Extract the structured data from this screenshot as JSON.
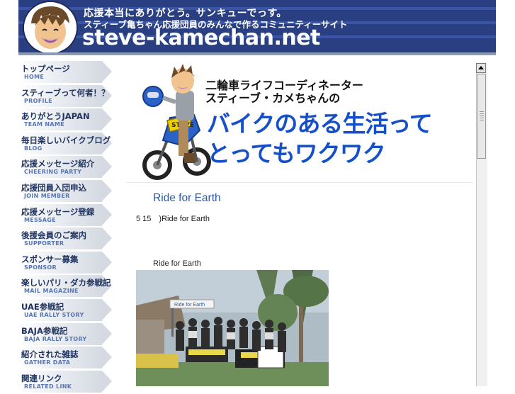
{
  "header": {
    "tagline_1": "応援本当にありがとう。サンキューでっす。",
    "tagline_2": "スティーブ亀ちゃん応援団員のみんなで作るコミュニティーサイト",
    "site_title": "steve-kamechan.net",
    "background_color": "#2a3f82"
  },
  "nav": [
    {
      "label": "トップページ",
      "sub": "HOME"
    },
    {
      "label": "スティーブって何者！？",
      "sub": "PROFILE"
    },
    {
      "label": "ありがとうJAPAN",
      "sub": "TEAM NAME"
    },
    {
      "label": "毎日楽しいバイクブログ",
      "sub": "BLOG"
    },
    {
      "label": "応援メッセージ紹介",
      "sub": "CHEERING PARTY"
    },
    {
      "label": "応援団員入団申込",
      "sub": "JOIN MEMBER"
    },
    {
      "label": "応援メッセージ登録",
      "sub": "MESSAGE"
    },
    {
      "label": "後援会員のご案内",
      "sub": "SUPPORTER"
    },
    {
      "label": "スポンサー募集",
      "sub": "SPONSOR"
    },
    {
      "label": "楽しいパリ・ダカ参戦記",
      "sub": "MAIL MAGAZINE"
    },
    {
      "label": "UAE参戦記",
      "sub": "UAE RALLY STORY"
    },
    {
      "label": "BAJA参戦記",
      "sub": "BAJA RALLY STORY"
    },
    {
      "label": "紹介された雑誌",
      "sub": "GATHER DATA"
    },
    {
      "label": "関連リンク",
      "sub": "RELATED LINK"
    }
  ],
  "banner": {
    "line_1": "二輪車ライフコーディネーター",
    "line_2": "スティーブ・カメちゃんの",
    "line_3": "バイクのある生活って",
    "line_4": "とってもワクワク",
    "plate_text": "STEVE",
    "accent_color": "#1650c8"
  },
  "post": {
    "title": "Ride for Earth",
    "date_line": "5 15　)Ride for Earth",
    "caption": "Ride for Earth",
    "photo_sign": "Ride for Earth"
  },
  "colors": {
    "nav_text": "#20345f",
    "nav_sub_text": "#5876b4",
    "link": "#2a5aa8"
  }
}
